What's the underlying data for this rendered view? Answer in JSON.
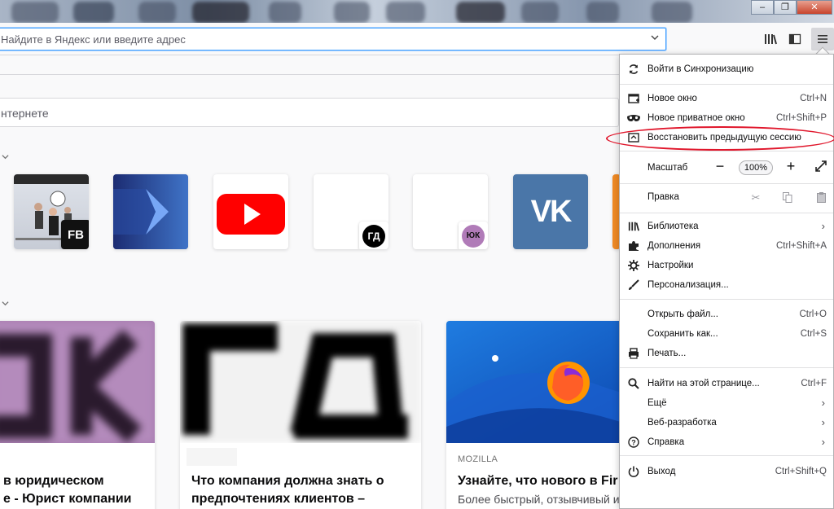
{
  "window": {
    "minimize_glyph": "–",
    "restore_glyph": "❐",
    "close_glyph": "✕"
  },
  "navbar": {
    "url_placeholder": "Найдите в Яндекс или введите адрес",
    "icons": [
      "library-icon",
      "sidebar-icon",
      "hamburger-menu-icon"
    ]
  },
  "newtab": {
    "search_placeholder": "нтернете",
    "topsites": [
      {
        "name": "fb",
        "badge": "FB"
      },
      {
        "name": "arrow-site"
      },
      {
        "name": "youtube"
      },
      {
        "name": "gd",
        "badge": "ГД"
      },
      {
        "name": "yuk",
        "badge": "ЮК"
      },
      {
        "name": "vk",
        "label": "VK"
      }
    ],
    "cards": [
      {
        "title": "в юридическом",
        "desc": "е - Юрист компании"
      },
      {
        "title": "Что компания должна знать о",
        "desc": "предпочтениях клиентов –"
      },
      {
        "source": "MOZILLA",
        "title": "Узнайте, что нового в Fir",
        "desc": "Более быстрый, отзывчивый и"
      }
    ]
  },
  "menu": {
    "sync": "Войти в Синхронизацию",
    "new_window": {
      "label": "Новое окно",
      "shortcut": "Ctrl+N"
    },
    "private_window": {
      "label": "Новое приватное окно",
      "shortcut": "Ctrl+Shift+P"
    },
    "restore_session": "Восстановить предыдущую сессию",
    "zoom": {
      "label": "Масштаб",
      "value": "100%",
      "minus": "−",
      "plus": "+"
    },
    "edit": "Правка",
    "library": "Библиотека",
    "addons": {
      "label": "Дополнения",
      "shortcut": "Ctrl+Shift+A"
    },
    "options": "Настройки",
    "customize": "Персонализация...",
    "open_file": {
      "label": "Открыть файл...",
      "shortcut": "Ctrl+O"
    },
    "save_as": {
      "label": "Сохранить как...",
      "shortcut": "Ctrl+S"
    },
    "print": "Печать...",
    "find": {
      "label": "Найти на этой странице...",
      "shortcut": "Ctrl+F"
    },
    "more": "Ещё",
    "webdev": "Веб-разработка",
    "help": "Справка",
    "quit": {
      "label": "Выход",
      "shortcut": "Ctrl+Shift+Q"
    }
  },
  "colors": {
    "accent": "#45a1ff",
    "annotation": "#e0162b",
    "youtube": "#ff0000",
    "vk": "#4a76a8"
  }
}
